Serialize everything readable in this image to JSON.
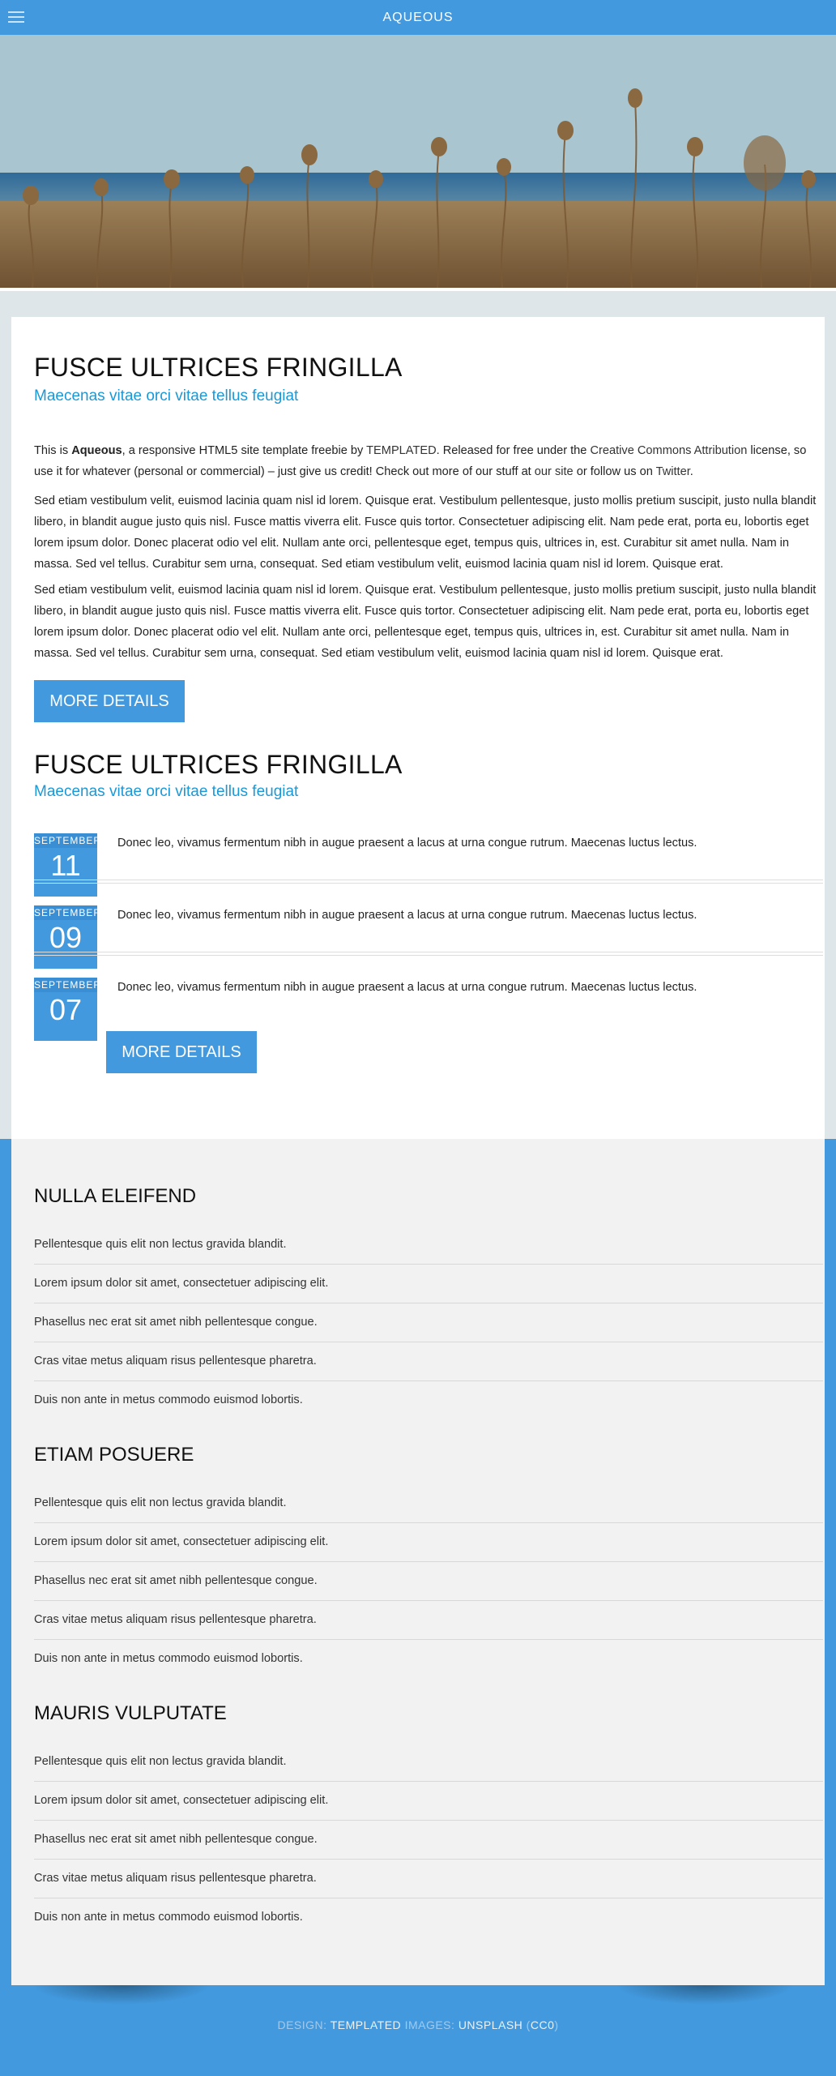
{
  "header": {
    "title": "Aqueous",
    "menu_icon": "hamburger-menu-icon"
  },
  "hero": {
    "description_icon": "hero-photo"
  },
  "section1": {
    "title": "Fusce ultrices fringilla",
    "subtitle": "Maecenas vitae orci vitae tellus feugiat",
    "intro": {
      "p1": "This is ",
      "brand": "Aqueous",
      "p2": ", a responsive HTML5 site template freebie by ",
      "link_templated": "TEMPLATED",
      "p3": ". Released for free under the ",
      "link_license": "Creative Commons Attribution",
      "p4": " license, so use it for whatever (personal or commercial) – just give us credit! Check out more of our stuff at ",
      "link_site": "our site",
      "p5": " or follow us on ",
      "link_twitter": "Twitter",
      "p6": "."
    },
    "paragraph2": "Sed etiam vestibulum velit, euismod lacinia quam nisl id lorem. Quisque erat. Vestibulum pellentesque, justo mollis pretium suscipit, justo nulla blandit libero, in blandit augue justo quis nisl. Fusce mattis viverra elit. Fusce quis tortor. Consectetuer adipiscing elit. Nam pede erat, porta eu, lobortis eget lorem ipsum dolor. Donec placerat odio vel elit. Nullam ante orci, pellentesque eget, tempus quis, ultrices in, est. Curabitur sit amet nulla. Nam in massa. Sed vel tellus. Curabitur sem urna, consequat. Sed etiam vestibulum velit, euismod lacinia quam nisl id lorem. Quisque erat.",
    "paragraph3": "Sed etiam vestibulum velit, euismod lacinia quam nisl id lorem. Quisque erat. Vestibulum pellentesque, justo mollis pretium suscipit, justo nulla blandit libero, in blandit augue justo quis nisl. Fusce mattis viverra elit. Fusce quis tortor. Consectetuer adipiscing elit. Nam pede erat, porta eu, lobortis eget lorem ipsum dolor. Donec placerat odio vel elit. Nullam ante orci, pellentesque eget, tempus quis, ultrices in, est. Curabitur sit amet nulla. Nam in massa. Sed vel tellus. Curabitur sem urna, consequat. Sed etiam vestibulum velit, euismod lacinia quam nisl id lorem. Quisque erat.",
    "button": "More Details"
  },
  "section2": {
    "title": "Fusce ultrices fringilla",
    "subtitle": "Maecenas vitae orci vitae tellus feugiat",
    "events": [
      {
        "month": "September",
        "day": "11",
        "text": "Donec leo, vivamus fermentum nibh in augue praesent a lacus at urna congue rutrum. Maecenas luctus lectus."
      },
      {
        "month": "September",
        "day": "09",
        "text": "Donec leo, vivamus fermentum nibh in augue praesent a lacus at urna congue rutrum. Maecenas luctus lectus."
      },
      {
        "month": "September",
        "day": "07",
        "text": "Donec leo, vivamus fermentum nibh in augue praesent a lacus at urna congue rutrum. Maecenas luctus lectus."
      }
    ],
    "button": "More Details"
  },
  "lists": [
    {
      "title": "Nulla eleifend",
      "items": [
        "Pellentesque quis elit non lectus gravida blandit.",
        "Lorem ipsum dolor sit amet, consectetuer adipiscing elit.",
        "Phasellus nec erat sit amet nibh pellentesque congue.",
        "Cras vitae metus aliquam risus pellentesque pharetra.",
        "Duis non ante in metus commodo euismod lobortis."
      ]
    },
    {
      "title": "Etiam posuere",
      "items": [
        "Pellentesque quis elit non lectus gravida blandit.",
        "Lorem ipsum dolor sit amet, consectetuer adipiscing elit.",
        "Phasellus nec erat sit amet nibh pellentesque congue.",
        "Cras vitae metus aliquam risus pellentesque pharetra.",
        "Duis non ante in metus commodo euismod lobortis."
      ]
    },
    {
      "title": "Mauris vulputate",
      "items": [
        "Pellentesque quis elit non lectus gravida blandit.",
        "Lorem ipsum dolor sit amet, consectetuer adipiscing elit.",
        "Phasellus nec erat sit amet nibh pellentesque congue.",
        "Cras vitae metus aliquam risus pellentesque pharetra.",
        "Duis non ante in metus commodo euismod lobortis."
      ]
    }
  ],
  "footer": {
    "design_label": "Design:",
    "design_link": "TEMPLATED",
    "images_label": "Images:",
    "images_link": "Unsplash",
    "license_link": "CC0"
  },
  "colors": {
    "accent": "#4299de",
    "subtitle": "#1b98d6",
    "panel": "#ffffff",
    "lower_panel": "#f2f2f2"
  }
}
